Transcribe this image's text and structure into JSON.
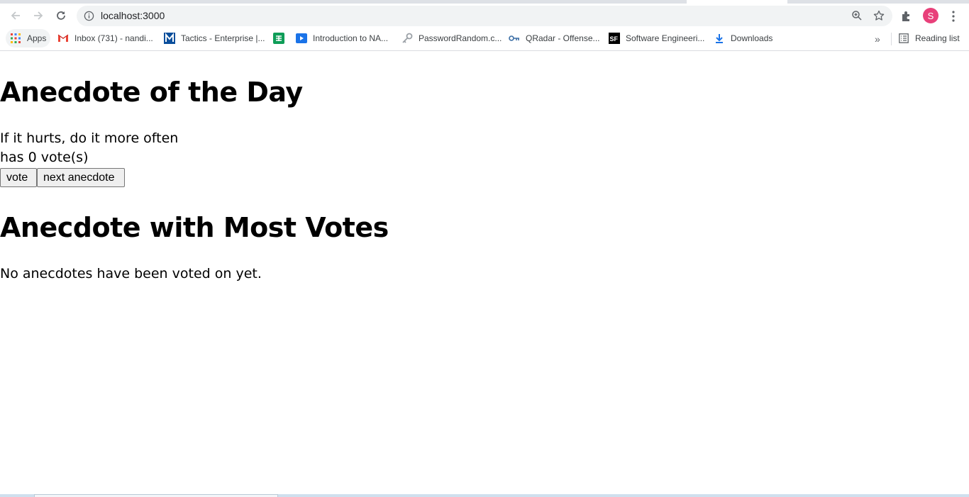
{
  "browser": {
    "url": "localhost:3000",
    "avatar_letter": "S",
    "bookmarks": [
      {
        "label": "Apps",
        "icon": "apps-grid-icon"
      },
      {
        "label": "Inbox (731) - nandi...",
        "icon": "gmail-icon"
      },
      {
        "label": "Tactics - Enterprise |...",
        "icon": "mitre-icon"
      },
      {
        "label": "",
        "icon": "sheets-icon"
      },
      {
        "label": "Introduction to NA...",
        "icon": "video-icon"
      },
      {
        "label": "PasswordRandom.c...",
        "icon": "key-icon"
      },
      {
        "label": "QRadar - Offense...",
        "icon": "qradar-icon"
      },
      {
        "label": "Software Engineeri...",
        "icon": "sf-icon"
      },
      {
        "label": "Downloads",
        "icon": "download-icon"
      }
    ],
    "overflow_label": "»",
    "reading_list": "Reading list"
  },
  "page": {
    "heading_day": "Anecdote of the Day",
    "anecdote_text": "If it hurts, do it more often",
    "votes_text": "has 0 vote(s)",
    "vote_button": "vote",
    "next_button": "next anecdote",
    "heading_most": "Anecdote with Most Votes",
    "no_votes_text": "No anecdotes have been voted on yet."
  },
  "colors": {
    "accent_avatar": "#e8407a",
    "chrome_bg": "#f1f3f4"
  }
}
